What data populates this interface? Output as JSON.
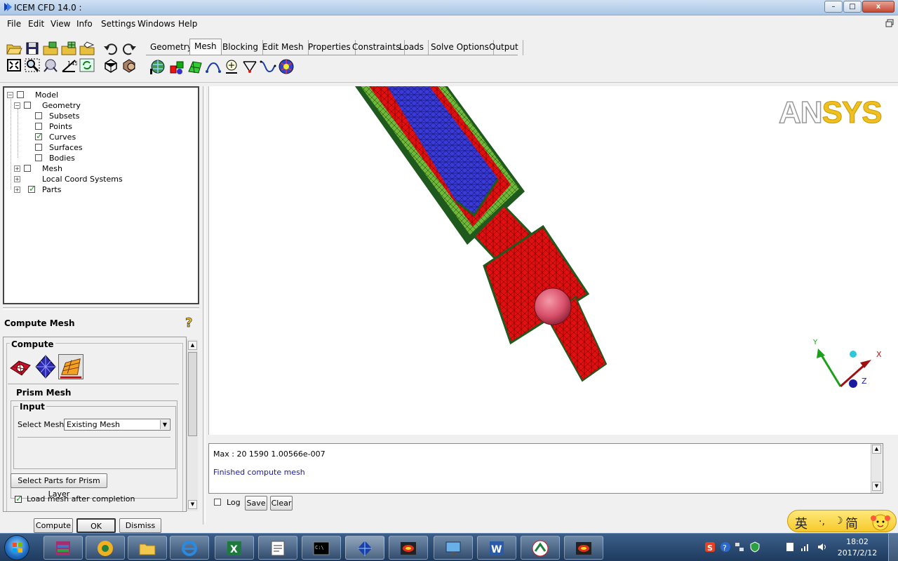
{
  "window": {
    "title": "ICEM CFD 14.0 :",
    "controls": [
      "–",
      "□",
      "x"
    ]
  },
  "menu": [
    "File",
    "Edit",
    "View",
    "Info",
    "Settings",
    "Windows",
    "Help"
  ],
  "tabs": [
    "Geometry",
    "Mesh",
    "Blocking",
    "Edit Mesh",
    "Properties",
    "Constraints",
    "Loads",
    "Solve Options",
    "Output"
  ],
  "active_tab": "Mesh",
  "tree": {
    "model": "Model",
    "geometry": "Geometry",
    "subsets": "Subsets",
    "points": "Points",
    "curves": "Curves",
    "surfaces": "Surfaces",
    "bodies": "Bodies",
    "mesh": "Mesh",
    "local_coord": "Local Coord Systems",
    "parts": "Parts"
  },
  "panel": {
    "title": "Compute Mesh",
    "compute_label": "Compute",
    "prism_mesh_label": "Prism Mesh",
    "input_label": "Input",
    "select_mesh_label": "Select Mesh",
    "select_mesh_value": "Existing Mesh",
    "select_parts_button": "Select Parts for Prism Layer",
    "load_mesh_label": "Load mesh after completion",
    "load_mesh_checked": true,
    "compute_button": "Compute",
    "ok_button": "OK",
    "dismiss_button": "Dismiss"
  },
  "viewport": {
    "logo_left": "AN",
    "logo_right": "SYS",
    "axes": {
      "x": "X",
      "y": "Y",
      "z": "Z"
    }
  },
  "messages": {
    "line1": "Max : 20 1590 1.00566e-007",
    "line2": "Finished compute mesh",
    "log_label": "Log",
    "save_button": "Save",
    "clear_button": "Clear"
  },
  "ime": {
    "lang": "英",
    "punct": "·,",
    "moon": "☽",
    "mode": "简"
  },
  "taskbar": {
    "time": "18:02",
    "date": "2017/2/12"
  },
  "colors": {
    "mesh_red": "#e11010",
    "mesh_blue": "#3a3ad8",
    "mesh_green": "#6fb83a",
    "mesh_dark_green": "#1e5a1e",
    "sphere": "#d8506a",
    "accent_blue": "#1a1aa0"
  }
}
